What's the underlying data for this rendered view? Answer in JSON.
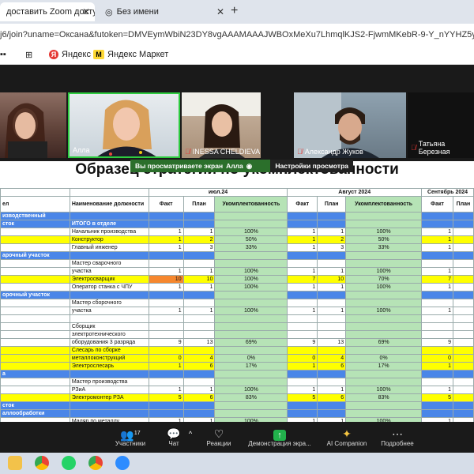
{
  "browser": {
    "tab1_title": "доставить Zoom доступ к",
    "tab2_title": "Без имени",
    "new_tab_symbol": "+",
    "url": "j6/join?uname=Оксана&futoken=DMVEymWbiN23DY8vgAAAMAAAJWBOxMeXu7LhmqlKJS2-FjwmMKebR-9-Y_nYYHZ5y5nuOn1kXlfhHJ30",
    "bookmarks": [
      {
        "label": "Яндекс",
        "icon": "yandex-icon"
      },
      {
        "label": "Яндекс Маркет",
        "icon": "yandex-market-icon"
      }
    ]
  },
  "participants": [
    {
      "name": "",
      "muted": false
    },
    {
      "name": "Алла",
      "muted": false
    },
    {
      "name": "INESSA CHELDIEVA",
      "muted": true
    },
    {
      "name": "Александр Жуков",
      "muted": true
    },
    {
      "name": "Татьяна Березная",
      "muted": true
    }
  ],
  "share_bar": {
    "message": "Вы просматриваете экран",
    "presenter": "Алла",
    "options": "Настройки просмотра"
  },
  "sheet": {
    "title": "Образец стратегии по укомплектованности",
    "months": [
      "июл.24",
      "Август 2024",
      "Сентябрь 2024"
    ],
    "col_headers": {
      "dept": "ел",
      "position": "Наименование должности",
      "fact": "Факт",
      "plan": "План",
      "staffing": "Укомплектованность"
    },
    "rows": [
      {
        "type": "sec",
        "dept": "изводственный",
        "pos": "",
        "v": [
          "",
          "",
          "",
          "",
          "",
          "",
          "",
          ""
        ]
      },
      {
        "type": "sec",
        "dept": "сток",
        "pos": "ИТОГО в отделе",
        "v": [
          "",
          "",
          "",
          "",
          "",
          "",
          "",
          ""
        ]
      },
      {
        "type": "n",
        "dept": "",
        "pos": "Начальник производства",
        "v": [
          "1",
          "1",
          "100%",
          "1",
          "1",
          "100%",
          "1",
          ""
        ]
      },
      {
        "type": "y",
        "dept": "",
        "pos": "Конструктор",
        "v": [
          "1",
          "2",
          "50%",
          "1",
          "2",
          "50%",
          "1",
          ""
        ]
      },
      {
        "type": "n",
        "dept": "",
        "pos": "Главный инженер",
        "v": [
          "1",
          "3",
          "33%",
          "1",
          "3",
          "33%",
          "1",
          ""
        ]
      },
      {
        "type": "sec",
        "dept": "арочный участок",
        "pos": "",
        "v": [
          "",
          "",
          "",
          "",
          "",
          "",
          "",
          ""
        ]
      },
      {
        "type": "n",
        "dept": "",
        "pos": "Мастер сварочного",
        "v": [
          "",
          "",
          "",
          "",
          "",
          "",
          "",
          ""
        ]
      },
      {
        "type": "n",
        "dept": "",
        "pos": "участка",
        "v": [
          "1",
          "1",
          "100%",
          "1",
          "1",
          "100%",
          "1",
          ""
        ]
      },
      {
        "type": "y",
        "dept": "",
        "pos": "Электросварщик",
        "v": [
          "10",
          "10",
          "100%",
          "7",
          "10",
          "70%",
          "7",
          ""
        ],
        "orange": true
      },
      {
        "type": "n",
        "dept": "",
        "pos": "Оператор станка с ЧПУ",
        "v": [
          "1",
          "1",
          "100%",
          "1",
          "1",
          "100%",
          "1",
          ""
        ]
      },
      {
        "type": "sec",
        "dept": "орочный участок",
        "pos": "",
        "v": [
          "",
          "",
          "",
          "",
          "",
          "",
          "",
          ""
        ]
      },
      {
        "type": "n",
        "dept": "",
        "pos": "Мастер сборочного",
        "v": [
          "",
          "",
          "",
          "",
          "",
          "",
          "",
          ""
        ]
      },
      {
        "type": "n",
        "dept": "",
        "pos": "участка",
        "v": [
          "1",
          "1",
          "100%",
          "1",
          "1",
          "100%",
          "1",
          ""
        ]
      },
      {
        "type": "n",
        "dept": "",
        "pos": "",
        "v": [
          "",
          "",
          "",
          "",
          "",
          "",
          "",
          ""
        ]
      },
      {
        "type": "n",
        "dept": "",
        "pos": "Сборщик",
        "v": [
          "",
          "",
          "",
          "",
          "",
          "",
          "",
          ""
        ]
      },
      {
        "type": "n",
        "dept": "",
        "pos": "электротехнического",
        "v": [
          "",
          "",
          "",
          "",
          "",
          "",
          "",
          ""
        ]
      },
      {
        "type": "n",
        "dept": "",
        "pos": "оборудования 3 разряда",
        "v": [
          "9",
          "13",
          "69%",
          "9",
          "13",
          "69%",
          "9",
          ""
        ]
      },
      {
        "type": "y",
        "dept": "",
        "pos": "Слесарь по сборке",
        "v": [
          "",
          "",
          "",
          "",
          "",
          "",
          "",
          ""
        ]
      },
      {
        "type": "y",
        "dept": "",
        "pos": "металлоконструкций",
        "v": [
          "0",
          "4",
          "0%",
          "0",
          "4",
          "0%",
          "0",
          ""
        ]
      },
      {
        "type": "y",
        "dept": "",
        "pos": "Электрослесарь",
        "v": [
          "1",
          "6",
          "17%",
          "1",
          "6",
          "17%",
          "1",
          ""
        ]
      },
      {
        "type": "sec",
        "dept": "а",
        "pos": "",
        "v": [
          "",
          "",
          "",
          "",
          "",
          "",
          "",
          ""
        ]
      },
      {
        "type": "n",
        "dept": "",
        "pos": "Мастер производства",
        "v": [
          "",
          "",
          "",
          "",
          "",
          "",
          "",
          ""
        ]
      },
      {
        "type": "n",
        "dept": "",
        "pos": "РЗиА",
        "v": [
          "1",
          "1",
          "100%",
          "1",
          "1",
          "100%",
          "1",
          ""
        ]
      },
      {
        "type": "y",
        "dept": "",
        "pos": "Электромонтер РЗА",
        "v": [
          "5",
          "6",
          "83%",
          "5",
          "6",
          "83%",
          "5",
          ""
        ]
      },
      {
        "type": "sec",
        "dept": "сток",
        "pos": "",
        "v": [
          "",
          "",
          "",
          "",
          "",
          "",
          "",
          ""
        ]
      },
      {
        "type": "sec",
        "dept": "аллообработки",
        "pos": "",
        "v": [
          "",
          "",
          "",
          "",
          "",
          "",
          "",
          ""
        ]
      },
      {
        "type": "n",
        "dept": "",
        "pos": "Маляр по металлу",
        "v": [
          "1",
          "1",
          "100%",
          "1",
          "1",
          "100%",
          "1",
          ""
        ]
      },
      {
        "type": "y",
        "dept": "",
        "pos": "Помощник маляра по",
        "v": [
          "",
          "",
          "",
          "",
          "",
          "",
          "",
          ""
        ]
      },
      {
        "type": "y",
        "dept": "",
        "pos": "металлу",
        "v": [
          "0",
          "1",
          "0%",
          "0",
          "1",
          "0%",
          "0",
          ""
        ]
      },
      {
        "type": "n",
        "dept": "",
        "pos": "Технический директор",
        "v": [
          "",
          "",
          "",
          "",
          "",
          "",
          "",
          ""
        ]
      },
      {
        "type": "sec",
        "dept": "ел",
        "pos": "",
        "v": [
          "",
          "",
          "",
          "",
          "",
          "",
          "",
          ""
        ]
      }
    ]
  },
  "zoom_toolbar": [
    {
      "label": "Участники",
      "icon": "participants-icon",
      "badge": "17"
    },
    {
      "label": "Чат",
      "icon": "chat-icon",
      "badge": ""
    },
    {
      "label": "Реакции",
      "icon": "heart-icon",
      "badge": ""
    },
    {
      "label": "Демонстрация экра...",
      "icon": "share-screen-icon",
      "badge": ""
    },
    {
      "label": "AI Companion",
      "icon": "sparkle-icon",
      "badge": ""
    },
    {
      "label": "Подробнее",
      "icon": "more-icon",
      "badge": ""
    }
  ],
  "taskbar_icons": [
    "file-explorer-icon",
    "chrome-browser-icon",
    "whatsapp-icon",
    "chrome-icon",
    "zoom-icon"
  ],
  "colors": {
    "section_blue": "#4a86e8",
    "highlight_yellow": "#ffff00",
    "staffing_green": "#b6e3b6",
    "share_green": "#2b6f2b",
    "toolbar_dark": "#1a1a1a"
  }
}
